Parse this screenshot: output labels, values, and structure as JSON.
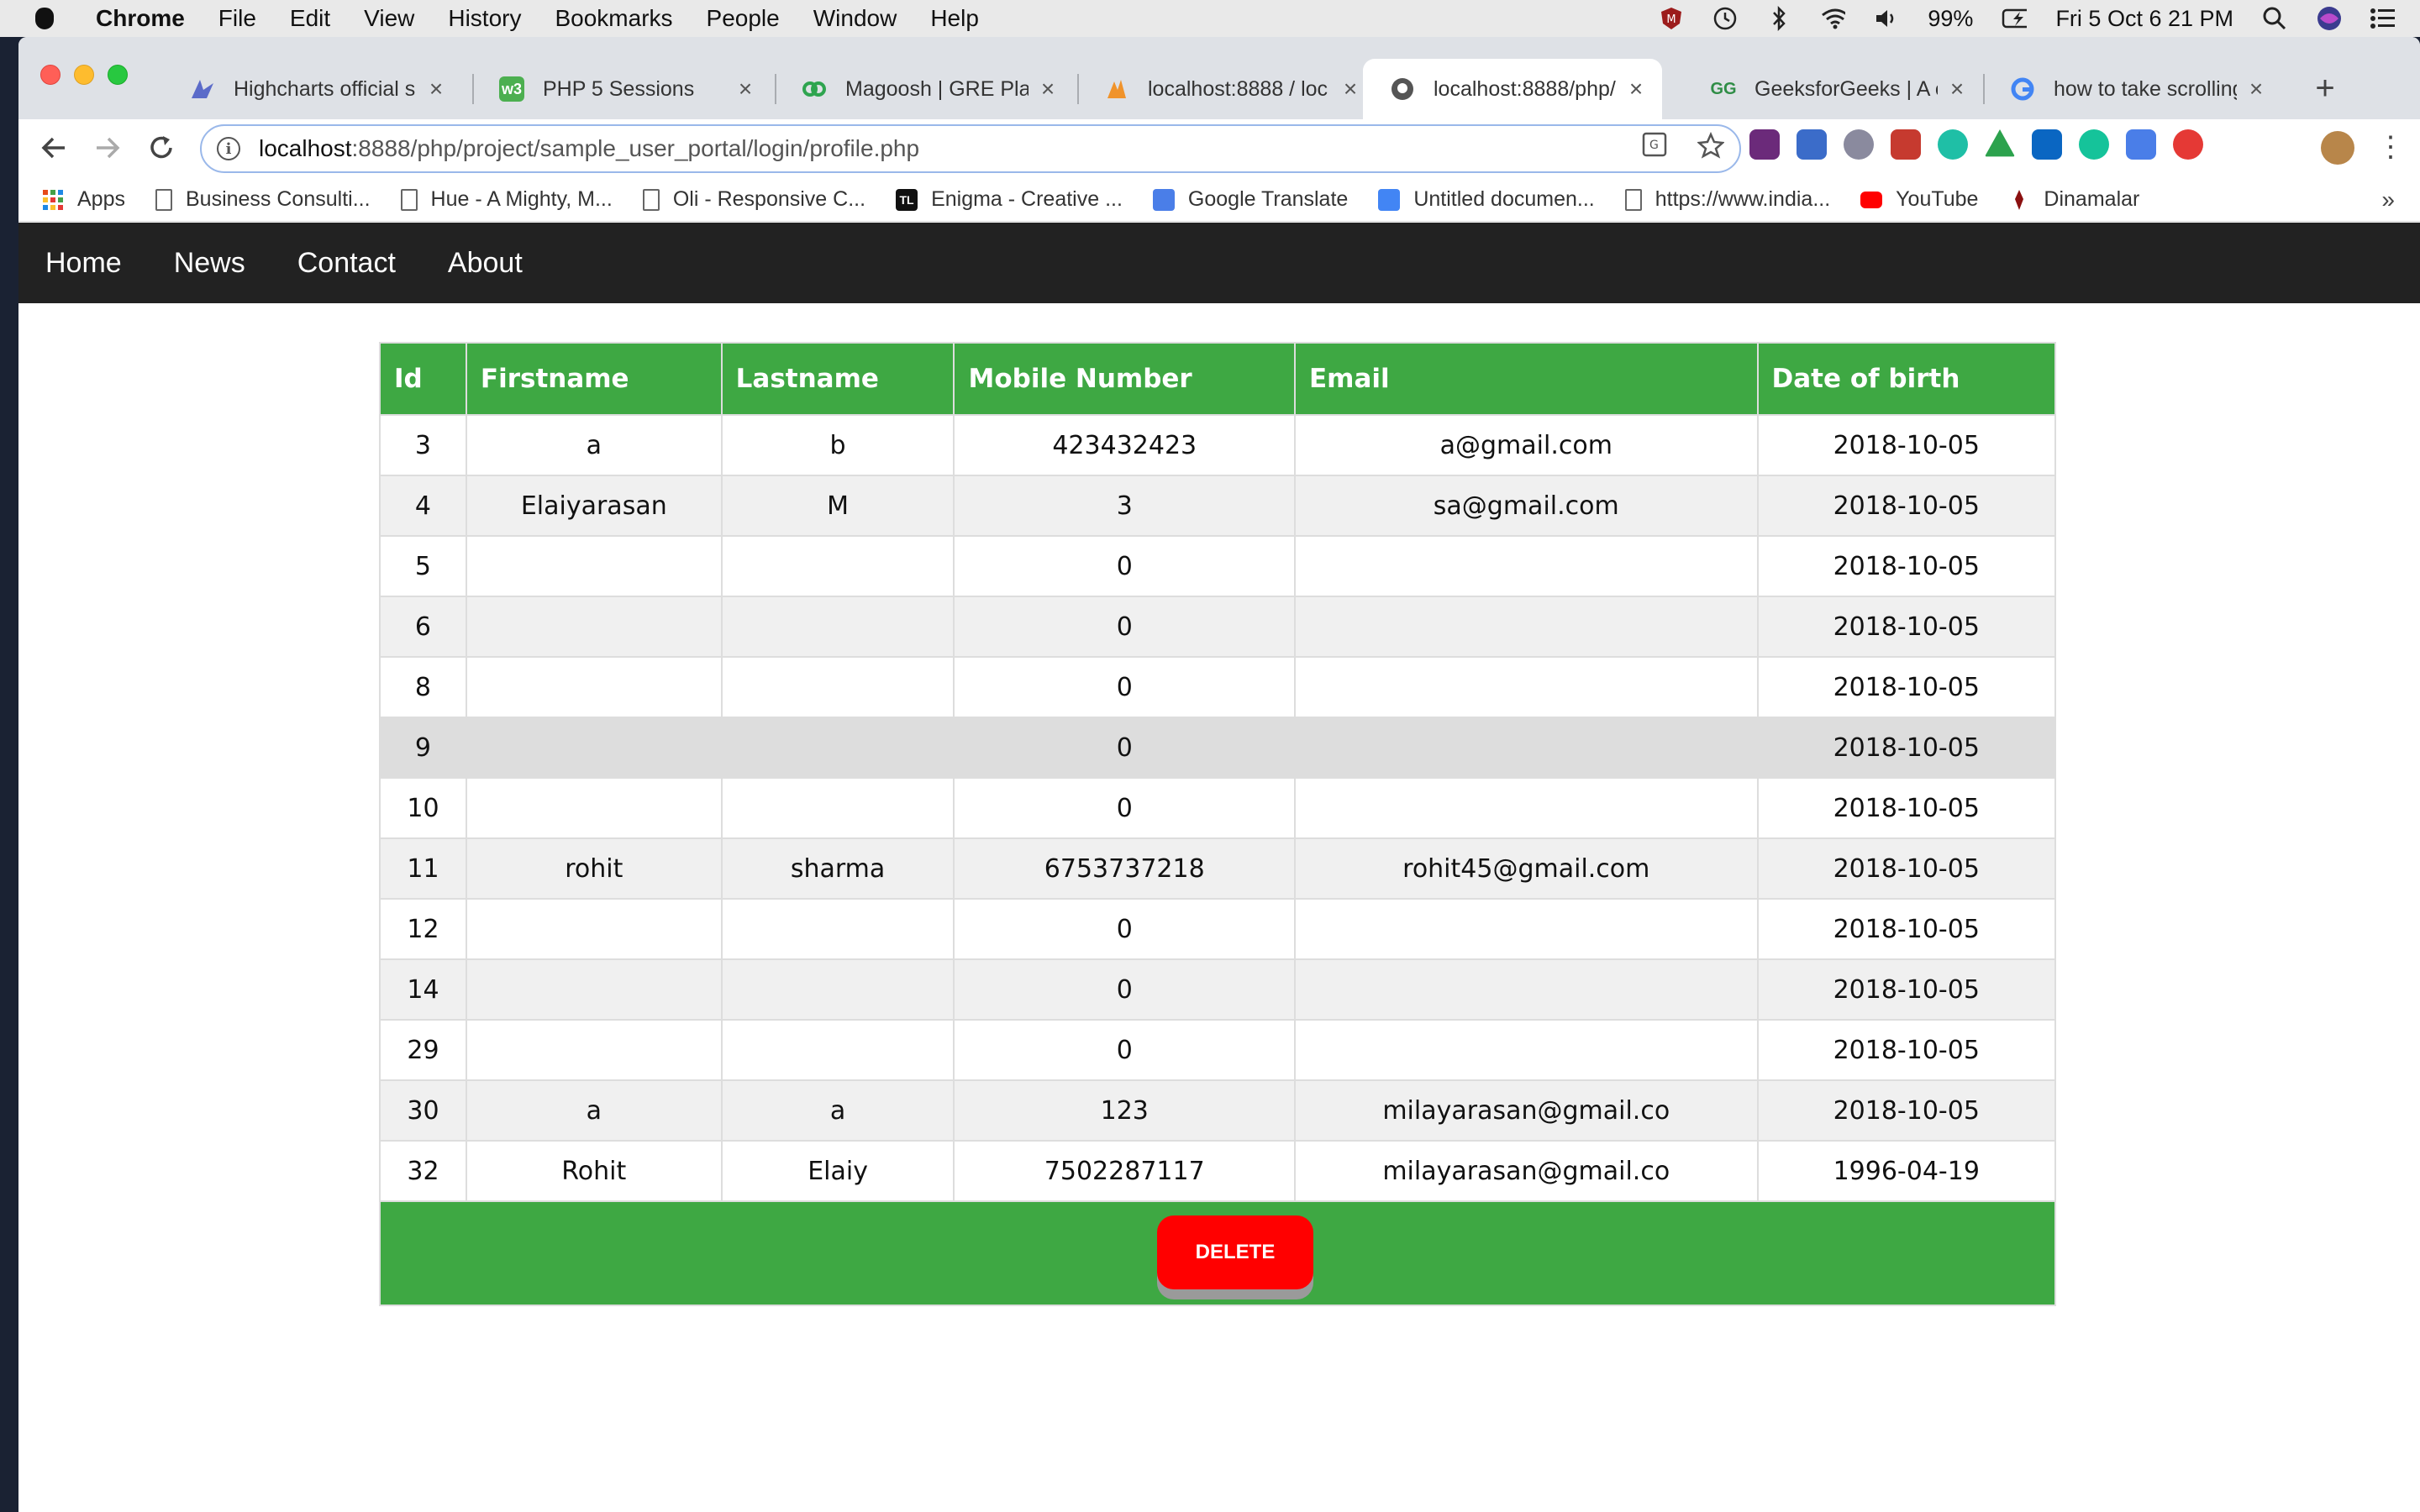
{
  "menubar": {
    "app_name": "Chrome",
    "items": [
      "File",
      "Edit",
      "View",
      "History",
      "Bookmarks",
      "People",
      "Window",
      "Help"
    ],
    "battery": "99%",
    "clock": "Fri 5 Oct  6 21 PM"
  },
  "tabs": [
    {
      "title": "Highcharts official s",
      "icon_color": "#5b6bc9"
    },
    {
      "title": "PHP 5 Sessions",
      "icon_color": "#4caf50"
    },
    {
      "title": "Magoosh | GRE Plan",
      "icon_color": "#2ea44f"
    },
    {
      "title": "localhost:8888 / loc",
      "icon_color": "#f0932b"
    },
    {
      "title": "localhost:8888/php/",
      "icon_color": "#555555"
    },
    {
      "title": "GeeksforGeeks | A c",
      "icon_color": "#2f8d46"
    },
    {
      "title": "how to take scrolling",
      "icon_color": "#4285f4"
    }
  ],
  "address_bar": {
    "host": "localhost",
    "path": ":8888/php/project/sample_user_portal/login/profile.php"
  },
  "bookmarks": [
    {
      "label": "Apps",
      "icon": "apps-grid-icon"
    },
    {
      "label": "Business Consulti...",
      "icon": "page-icon"
    },
    {
      "label": "Hue - A Mighty, M...",
      "icon": "page-icon"
    },
    {
      "label": "Oli - Responsive C...",
      "icon": "page-icon"
    },
    {
      "label": "Enigma - Creative ...",
      "icon": "tl-logo-icon"
    },
    {
      "label": "Google Translate",
      "icon": "google-translate-icon"
    },
    {
      "label": "Untitled documen...",
      "icon": "google-docs-icon"
    },
    {
      "label": "https://www.india...",
      "icon": "page-icon"
    },
    {
      "label": "YouTube",
      "icon": "youtube-icon"
    },
    {
      "label": "Dinamalar",
      "icon": "dinamalar-icon"
    }
  ],
  "site_nav": [
    "Home",
    "News",
    "Contact",
    "About"
  ],
  "table": {
    "columns": [
      "Id",
      "Firstname",
      "Lastname",
      "Mobile Number",
      "Email",
      "Date of birth"
    ],
    "rows": [
      [
        "3",
        "a",
        "b",
        "423432423",
        "a@gmail.com",
        "2018-10-05"
      ],
      [
        "4",
        "Elaiyarasan",
        "M",
        "3",
        "sa@gmail.com",
        "2018-10-05"
      ],
      [
        "5",
        "",
        "",
        "0",
        "",
        "2018-10-05"
      ],
      [
        "6",
        "",
        "",
        "0",
        "",
        "2018-10-05"
      ],
      [
        "8",
        "",
        "",
        "0",
        "",
        "2018-10-05"
      ],
      [
        "9",
        "",
        "",
        "0",
        "",
        "2018-10-05"
      ],
      [
        "10",
        "",
        "",
        "0",
        "",
        "2018-10-05"
      ],
      [
        "11",
        "rohit",
        "sharma",
        "6753737218",
        "rohit45@gmail.com",
        "2018-10-05"
      ],
      [
        "12",
        "",
        "",
        "0",
        "",
        "2018-10-05"
      ],
      [
        "14",
        "",
        "",
        "0",
        "",
        "2018-10-05"
      ],
      [
        "29",
        "",
        "",
        "0",
        "",
        "2018-10-05"
      ],
      [
        "30",
        "a",
        "a",
        "123",
        "milayarasan@gmail.co",
        "2018-10-05"
      ],
      [
        "32",
        "Rohit",
        "Elaiy",
        "7502287117",
        "milayarasan@gmail.co",
        "1996-04-19"
      ]
    ],
    "hovered_row_id": "9"
  },
  "delete_label": "DELETE",
  "colors": {
    "header_green": "#3ea843",
    "navbar": "#222222",
    "delete_red": "#ff0000"
  }
}
